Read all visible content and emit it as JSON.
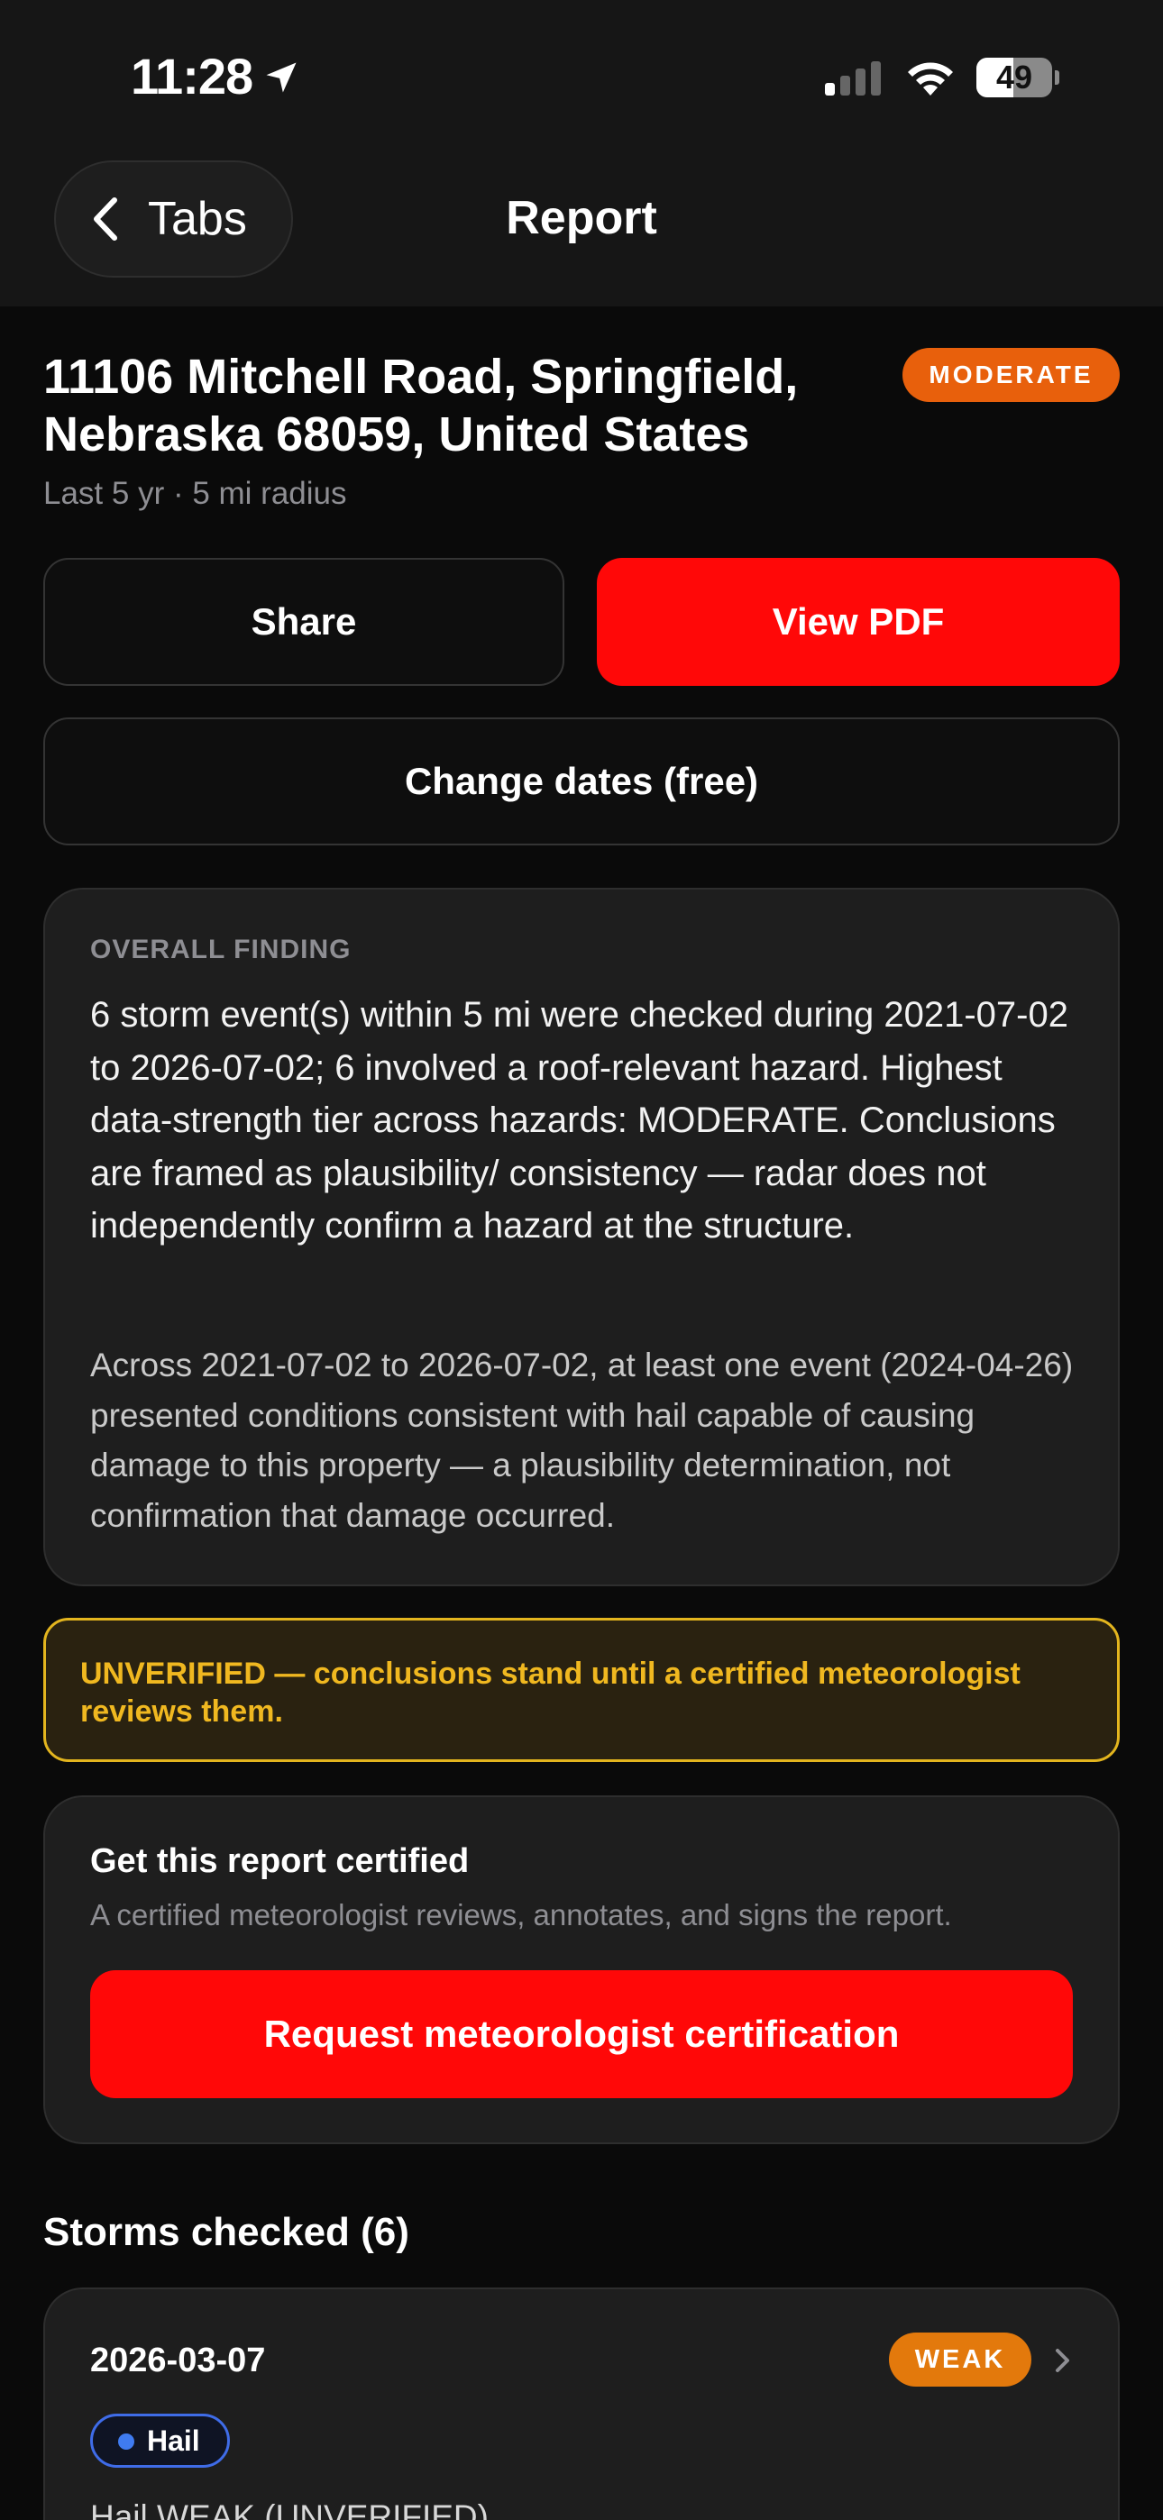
{
  "status_bar": {
    "time": "11:28",
    "battery": "49",
    "battery_level": 0.49
  },
  "nav": {
    "back_label": "Tabs",
    "title": "Report"
  },
  "report": {
    "address": "11106 Mitchell Road, Springfield, Nebraska 68059, United States",
    "tier": "MODERATE",
    "subtitle": "Last 5 yr · 5 mi radius"
  },
  "actions": {
    "share": "Share",
    "view_pdf": "View PDF",
    "change_dates": "Change dates (free)"
  },
  "finding": {
    "label": "OVERALL FINDING",
    "main": "6 storm event(s) within 5 mi were checked during 2021-07-02 to 2026-07-02; 6 involved a roof-relevant hazard. Highest data-strength tier across hazards: MODERATE. Conclusions are framed as plausibility/ consistency — radar does not independently confirm a hazard at the structure.",
    "detail": "Across 2021-07-02 to 2026-07-02, at least one event (2024-04-26) presented conditions consistent with hail capable of causing damage to this property — a plausibility determination, not confirmation that damage occurred."
  },
  "warning": "UNVERIFIED — conclusions stand until a certified meteorologist reviews them.",
  "certification": {
    "title": "Get this report certified",
    "subtitle": "A certified meteorologist reviews, annotates, and signs the report.",
    "button": "Request meteorologist certification"
  },
  "storms": {
    "title": "Storms checked (6)",
    "items": [
      {
        "date": "2026-03-07",
        "tier": "WEAK",
        "hazard": "Hail",
        "summary": "Hail WEAK (UNVERIFIED)"
      }
    ]
  },
  "colors": {
    "accent_red": "#ff0808",
    "moderate": "#e8600c",
    "weak": "#e3790c",
    "warning": "#f0b820",
    "hail": "#3f7bf0"
  }
}
